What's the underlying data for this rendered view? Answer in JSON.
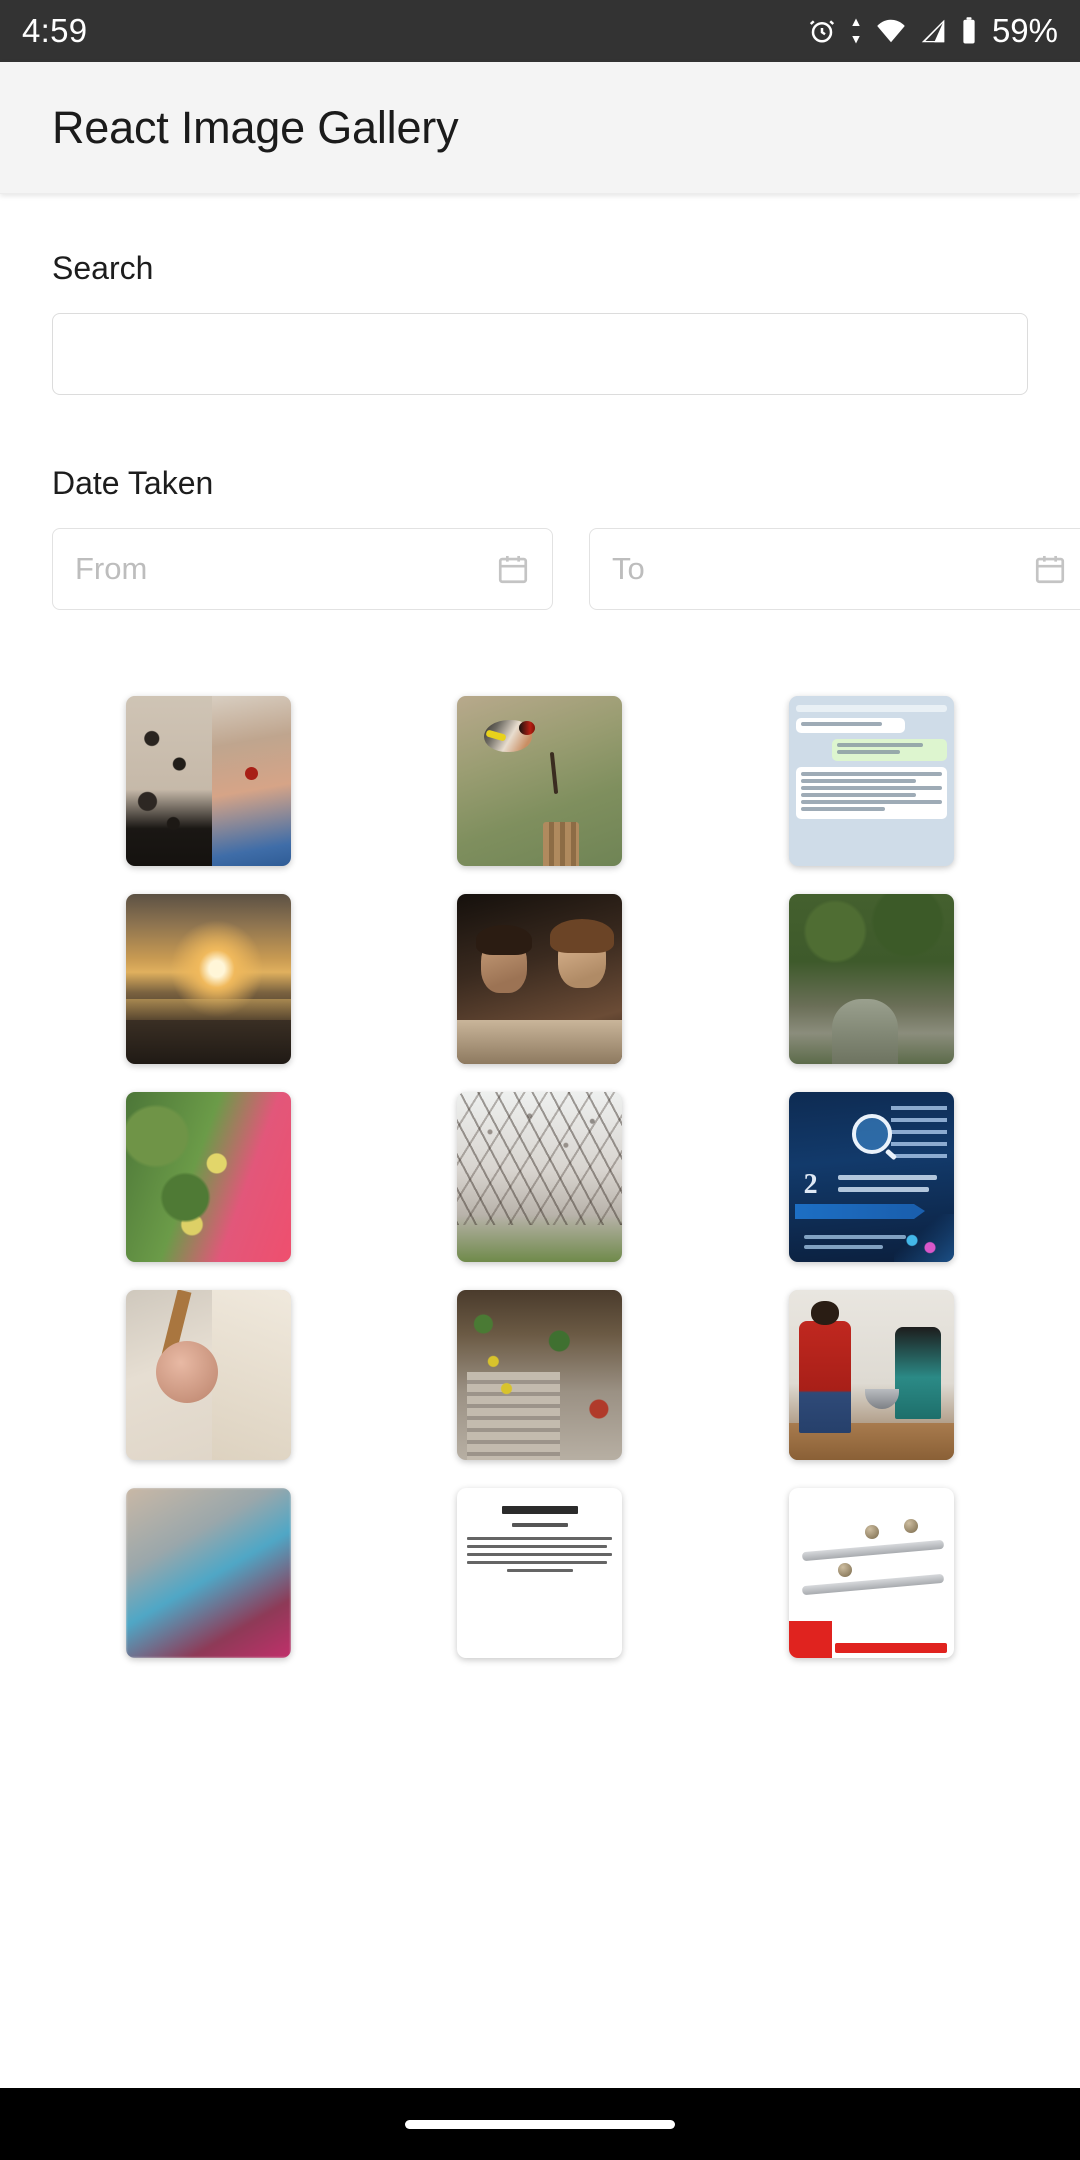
{
  "status_bar": {
    "time": "4:59",
    "battery_percent": "59%",
    "icons": [
      "alarm-icon",
      "sync-arrows-icon",
      "wifi-icon",
      "cellular-signal-icon",
      "battery-icon"
    ]
  },
  "app_bar": {
    "title": "React Image Gallery"
  },
  "filters": {
    "search_label": "Search",
    "search_value": "",
    "search_placeholder": "",
    "date_label": "Date Taken",
    "date_from_placeholder": "From",
    "date_from_value": "",
    "date_to_placeholder": "To",
    "date_to_value": "",
    "calendar_icon": "calendar-icon"
  },
  "gallery": {
    "columns": 3,
    "items": [
      {
        "id": 1,
        "alt": "split photo of dark textured surface and child with red mark on forehead",
        "art": "art-split"
      },
      {
        "id": 2,
        "alt": "goldfinch bird perched on a wooden post",
        "art": "art-bird"
      },
      {
        "id": 3,
        "alt": "messaging app chat screenshot with russian text",
        "art": "art-chat"
      },
      {
        "id": 4,
        "alt": "golden sunset over water with dark clouds",
        "art": "art-sunset"
      },
      {
        "id": 5,
        "alt": "couple selfie at night",
        "art": "art-couple"
      },
      {
        "id": 6,
        "alt": "green forest stream among mossy rocks",
        "art": "art-forest"
      },
      {
        "id": 7,
        "alt": "green leaves with yellow fruit over pink fabric",
        "art": "art-leaves"
      },
      {
        "id": 8,
        "alt": "orchard of blossoming trees",
        "art": "art-blossom"
      },
      {
        "id": 9,
        "alt": "dark blue financial infographic with magnifier and number 2",
        "art": "art-info"
      },
      {
        "id": 10,
        "alt": "newborn baby sleeping wrapped in a blanket",
        "art": "art-baby"
      },
      {
        "id": 11,
        "alt": "stone steps with potted flowers beside a doorway",
        "art": "art-steps"
      },
      {
        "id": 12,
        "alt": "man in red shirt cooking with a child at a table",
        "art": "art-kitchen"
      },
      {
        "id": 13,
        "alt": "blurred close-up photo",
        "art": "art-blur"
      },
      {
        "id": 14,
        "alt": "document page titled Autodidact",
        "art": "art-doc"
      },
      {
        "id": 15,
        "alt": "metal curtain rails with finials on white background",
        "art": "art-rail"
      }
    ]
  },
  "nav_bar": {
    "gesture_pill": "home-gesture-pill"
  },
  "colors": {
    "status_bar_bg": "#333333",
    "app_bar_bg": "#f4f4f4",
    "page_bg": "#ffffff",
    "text_primary": "#1d1d1d",
    "placeholder": "#bdbdbd",
    "border": "#dcdcdc",
    "nav_bar_bg": "#000000"
  }
}
